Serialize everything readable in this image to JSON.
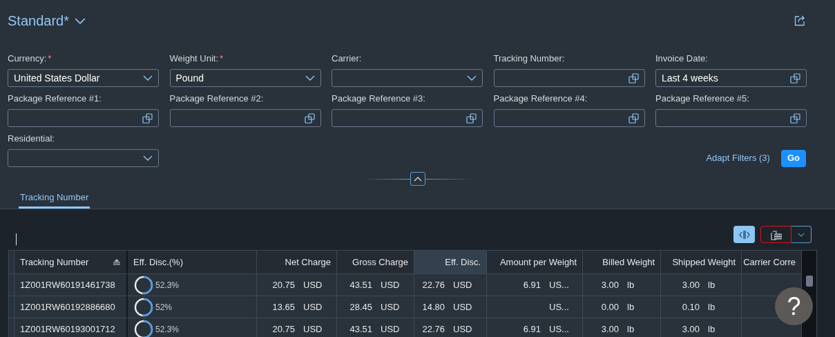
{
  "header": {
    "title": "Standard*"
  },
  "filters": [
    {
      "label": "Currency:",
      "required_mark": "*",
      "kind": "select",
      "value": "United States Dollar"
    },
    {
      "label": "Weight Unit:",
      "required_mark": "*",
      "kind": "select",
      "value": "Pound"
    },
    {
      "label": "Carrier:",
      "kind": "select"
    },
    {
      "label": "Tracking Number:",
      "kind": "valuehelp"
    },
    {
      "label": "Invoice Date:",
      "kind": "valuehelp",
      "value": "Last 4 weeks"
    },
    {
      "label": "Package Reference #1:",
      "kind": "valuehelp"
    },
    {
      "label": "Package Reference #2:",
      "kind": "valuehelp"
    },
    {
      "label": "Package Reference #3:",
      "kind": "valuehelp"
    },
    {
      "label": "Package Reference #4:",
      "kind": "valuehelp"
    },
    {
      "label": "Package Reference #5:",
      "kind": "valuehelp"
    },
    {
      "label": "Residential:",
      "kind": "select"
    }
  ],
  "adapt_filters": "Adapt Filters (3)",
  "go_button": "Go",
  "tabs": [
    {
      "label": "Tracking Number",
      "selected": true
    }
  ],
  "toolbar": {
    "toggle_selected": true,
    "export_outlined": true
  },
  "table": {
    "columns": [
      {
        "label": "Tracking Number",
        "sorted": true,
        "highlighted": false
      },
      {
        "label": "Eff. Disc.(%)",
        "sorted": false,
        "highlighted": false
      },
      {
        "label": "Net Charge",
        "sorted": false,
        "highlighted": false
      },
      {
        "label": "Gross Charge",
        "sorted": false,
        "highlighted": false
      },
      {
        "label": "Eff. Disc.",
        "sorted": false,
        "highlighted": true
      },
      {
        "label": "Amount per Weight",
        "sorted": false,
        "highlighted": false
      },
      {
        "label": "Billed Weight",
        "sorted": false,
        "highlighted": false
      },
      {
        "label": "Shipped Weight",
        "sorted": false,
        "highlighted": false
      },
      {
        "label": "Carrier Corre",
        "sorted": false,
        "highlighted": false
      }
    ],
    "rows": [
      {
        "cells": [
          {
            "kind": "text",
            "text": "1Z001RW60191461738"
          },
          {
            "kind": "ring",
            "text": "52.3%"
          },
          {
            "kind": "amount",
            "value": "20.75",
            "unit": "USD"
          },
          {
            "kind": "amount",
            "value": "43.51",
            "unit": "USD"
          },
          {
            "kind": "amount",
            "value": "22.76",
            "unit": "USD"
          },
          {
            "kind": "amount",
            "value": "6.91",
            "unit": "US..."
          },
          {
            "kind": "amount",
            "value": "3.00",
            "unit": "lb"
          },
          {
            "kind": "amount",
            "value": "3.00",
            "unit": "lb"
          }
        ]
      },
      {
        "cells": [
          {
            "kind": "text",
            "text": "1Z001RW60192886680"
          },
          {
            "kind": "ring",
            "text": "52%"
          },
          {
            "kind": "amount",
            "value": "13.65",
            "unit": "USD"
          },
          {
            "kind": "amount",
            "value": "28.45",
            "unit": "USD"
          },
          {
            "kind": "amount",
            "value": "14.80",
            "unit": "USD"
          },
          {
            "kind": "amount",
            "unit": "US..."
          },
          {
            "kind": "amount",
            "value": "0.00",
            "unit": "lb"
          },
          {
            "kind": "amount",
            "value": "0.10",
            "unit": "lb"
          }
        ]
      },
      {
        "cells": [
          {
            "kind": "text",
            "text": "1Z001RW60193001712"
          },
          {
            "kind": "ring",
            "text": "52.3%"
          },
          {
            "kind": "amount",
            "value": "20.75",
            "unit": "USD"
          },
          {
            "kind": "amount",
            "value": "43.51",
            "unit": "USD"
          },
          {
            "kind": "amount",
            "value": "22.76",
            "unit": "USD"
          },
          {
            "kind": "amount",
            "value": "6.91",
            "unit": "US..."
          },
          {
            "kind": "amount",
            "value": "3.00",
            "unit": "lb"
          },
          {
            "kind": "amount",
            "value": "3.00",
            "unit": "lb"
          }
        ]
      }
    ]
  },
  "help_button": "?"
}
